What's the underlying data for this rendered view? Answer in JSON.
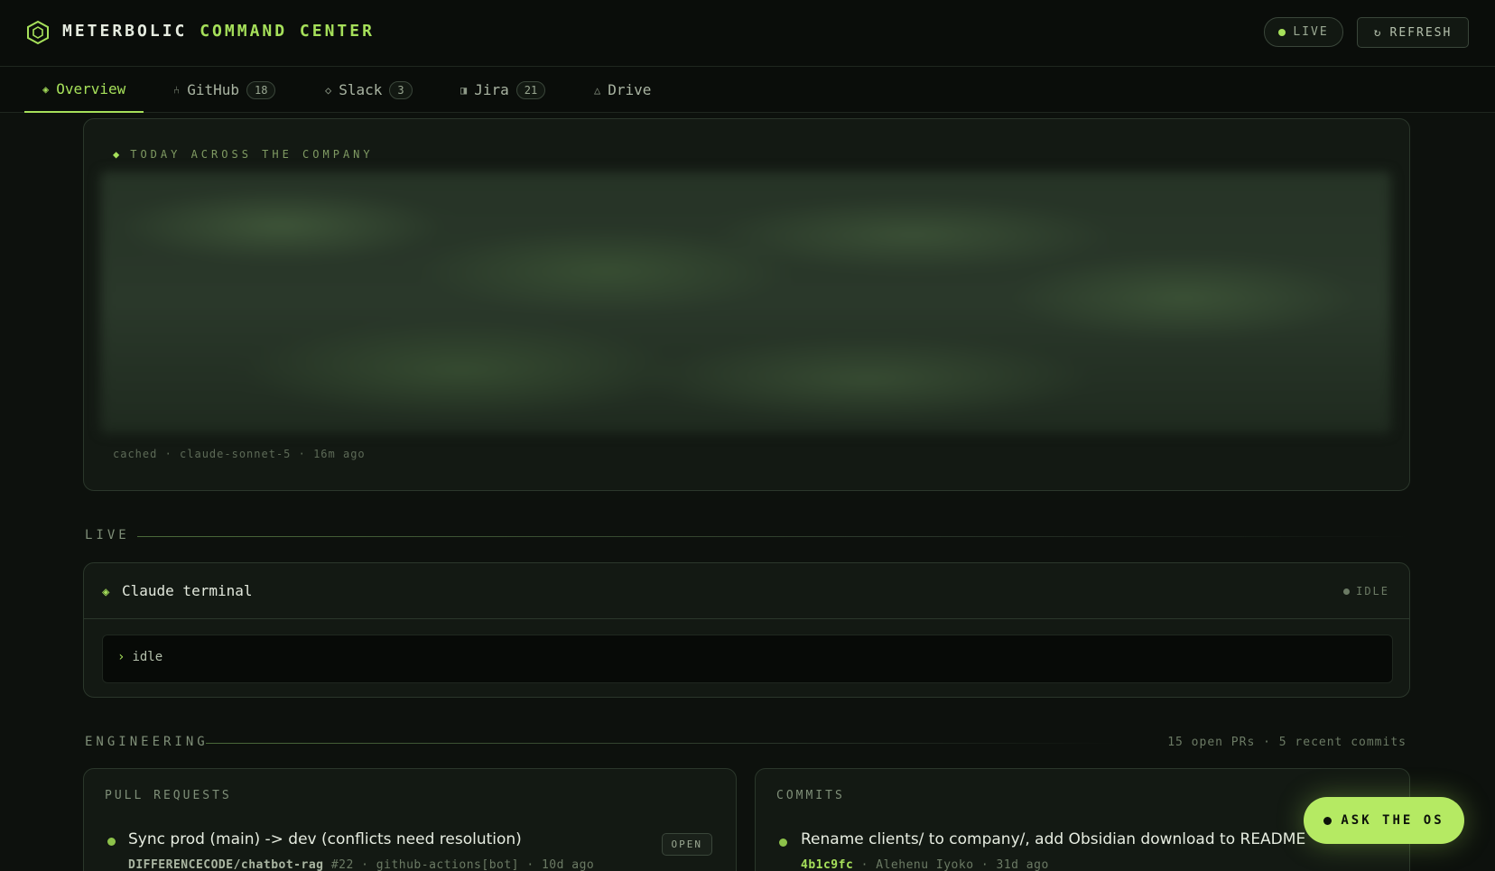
{
  "header": {
    "brand_primary": "METERBOLIC",
    "brand_secondary": "COMMAND CENTER",
    "live_label": "LIVE",
    "refresh_label": "REFRESH",
    "refresh_icon": "↻"
  },
  "tabs": [
    {
      "label": "Overview",
      "icon": "◈",
      "count": null
    },
    {
      "label": "GitHub",
      "icon": "⑃",
      "count": "18"
    },
    {
      "label": "Slack",
      "icon": "◇",
      "count": "3"
    },
    {
      "label": "Jira",
      "icon": "◨",
      "count": "21"
    },
    {
      "label": "Drive",
      "icon": "△",
      "count": null
    }
  ],
  "summary": {
    "label": "TODAY ACROSS THE COMPANY",
    "meta": "cached · claude-sonnet-5 · 16m ago"
  },
  "live": {
    "section_title": "LIVE",
    "terminal_title": "Claude terminal",
    "status": "IDLE",
    "prompt_text": "idle"
  },
  "engineering": {
    "section_title": "ENGINEERING",
    "meta": "15 open PRs · 5 recent commits",
    "pull_requests": {
      "label": "PULL REQUESTS",
      "items": [
        {
          "title": "Sync prod (main) -> dev (conflicts need resolution)",
          "repo": "DIFFERENCECODE/chatbot-rag",
          "details": "#22 · github-actions[bot] · 10d ago",
          "state": "OPEN"
        }
      ]
    },
    "commits": {
      "label": "COMMITS",
      "items": [
        {
          "title": "Rename clients/ to company/, add Obsidian download to README",
          "hash": "4b1c9fc",
          "details": "· Alehenu Iyoko · 31d ago"
        }
      ]
    }
  },
  "ask_button": {
    "label": "ASK THE OS"
  },
  "colors": {
    "accent": "#a6e05a",
    "background": "#0d110d",
    "card": "#131913"
  }
}
